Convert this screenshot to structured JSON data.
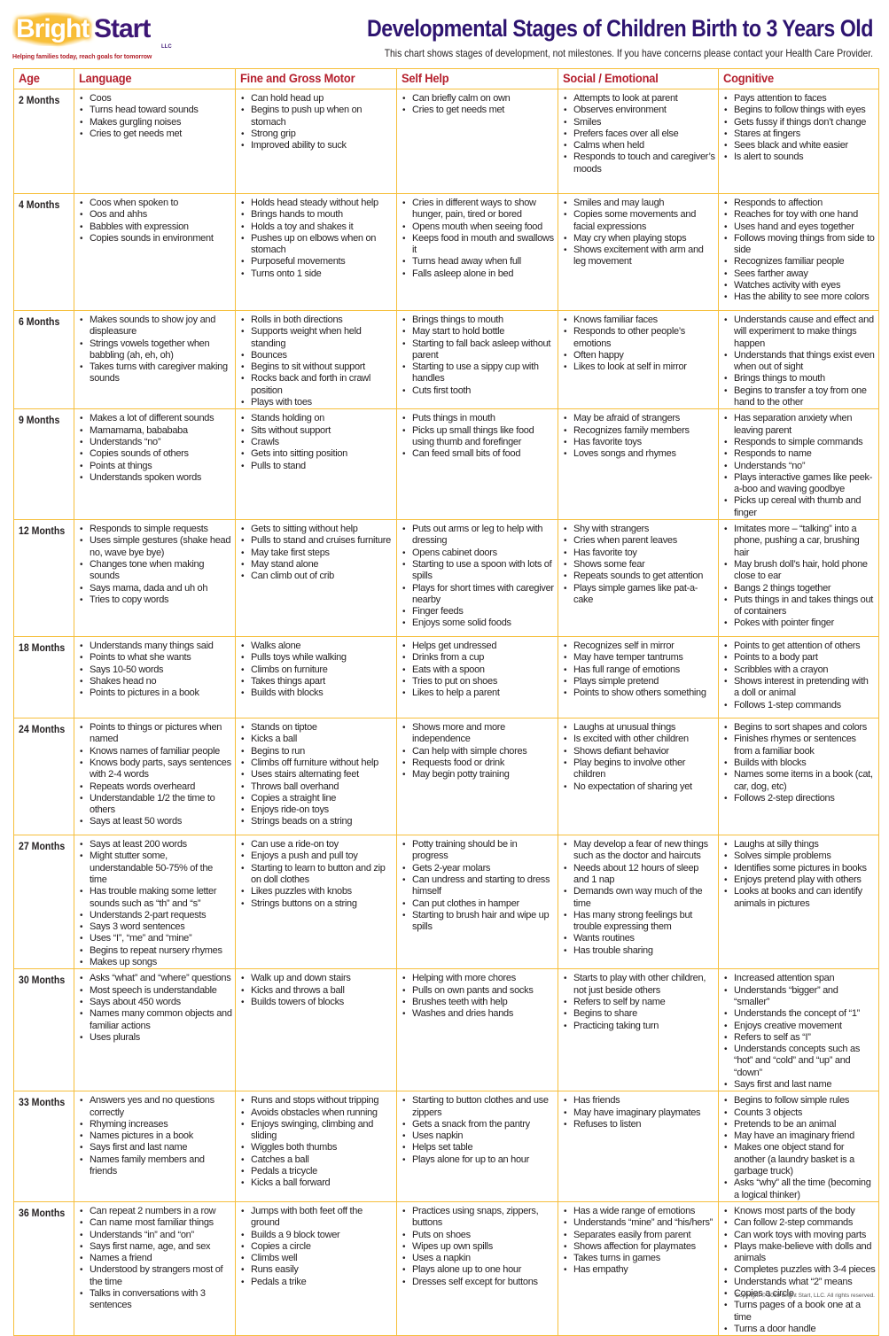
{
  "logo": {
    "bright": "Bright",
    "start": "Start",
    "llc": "LLC",
    "tagline": "Helping families today, reach goals for tomorrow",
    "colors": {
      "bright_glow": "#f8c03f",
      "start": "#3d1675",
      "tagline": "#b2202a"
    }
  },
  "header": {
    "title": "Developmental Stages of Children Birth to 3 Years Old",
    "subtitle": "This chart shows stages of development, not milestones. If you have concerns please contact your Health Care Provider."
  },
  "colors": {
    "title": "#2e1470",
    "column_header": "#b5202e",
    "grid": "#f6bf3c",
    "text": "#231f20"
  },
  "columns": [
    "Age",
    "Language",
    "Fine and Gross Motor",
    "Self Help",
    "Social / Emotional",
    "Cognitive"
  ],
  "rows": [
    {
      "age": "2 Months",
      "language": [
        "Coos",
        "Turns head toward sounds",
        "Makes gurgling noises",
        "Cries to get needs met"
      ],
      "motor": [
        "Can hold head up",
        "Begins to push up when on stomach",
        "Strong grip",
        "Improved ability to suck"
      ],
      "self_help": [
        "Can briefly calm on own",
        "Cries to get needs met"
      ],
      "social": [
        "Attempts to look at parent",
        "Observes environment",
        "Smiles",
        "Prefers faces over all else",
        "Calms when held",
        "Responds to touch and caregiver’s moods"
      ],
      "cognitive": [
        "Pays attention to faces",
        "Begins to follow things with eyes",
        "Gets fussy if things don’t change",
        "Stares at fingers",
        "Sees black and white easier",
        "Is alert to sounds"
      ]
    },
    {
      "age": "4 Months",
      "language": [
        "Coos when spoken to",
        "Oos and ahhs",
        "Babbles with expression",
        "Copies sounds in environment"
      ],
      "motor": [
        "Holds head steady without help",
        "Brings hands to mouth",
        "Holds a toy and shakes it",
        "Pushes up on elbows when on stomach",
        "Purposeful movements",
        "Turns onto 1 side"
      ],
      "self_help": [
        "Cries in different ways to show hunger, pain, tired or bored",
        "Opens mouth when seeing food",
        "Keeps food in mouth and swallows it",
        "Turns head away when full",
        "Falls asleep alone in bed"
      ],
      "social": [
        "Smiles and may laugh",
        "Copies some movements and facial expressions",
        "May cry when playing stops",
        "Shows excitement with arm and leg movement"
      ],
      "cognitive": [
        "Responds to affection",
        "Reaches for toy with one hand",
        "Uses hand and eyes together",
        "Follows moving things from side to side",
        "Recognizes familiar people",
        "Sees farther away",
        "Watches activity with eyes",
        "Has the ability to see more colors"
      ]
    },
    {
      "age": "6 Months",
      "language": [
        "Makes sounds to show joy and displeasure",
        "Strings vowels together when babbling (ah, eh, oh)",
        "Takes turns with caregiver making sounds"
      ],
      "motor": [
        "Rolls in both directions",
        "Supports weight when held standing",
        "Bounces",
        "Begins to sit without support",
        "Rocks back and forth in crawl position",
        "Plays with toes"
      ],
      "self_help": [
        "Brings things to mouth",
        "May start to hold bottle",
        "Starting to fall back asleep without parent",
        "Starting to use a sippy cup with handles",
        "Cuts first tooth"
      ],
      "social": [
        "Knows familiar faces",
        "Responds to other people’s emotions",
        "Often happy",
        "Likes to look at self in mirror"
      ],
      "cognitive": [
        "Understands cause and effect and will experiment to make things happen",
        "Understands that things exist even when out of sight",
        "Brings things to mouth",
        "Begins to transfer a toy from one hand to the other"
      ]
    },
    {
      "age": "9 Months",
      "language": [
        "Makes a lot of different sounds",
        "Mamamama, babababa",
        "Understands “no”",
        "Copies sounds of others",
        "Points at things",
        "Understands spoken words"
      ],
      "motor": [
        "Stands holding on",
        "Sits without support",
        "Crawls",
        "Gets into sitting position",
        "Pulls to stand"
      ],
      "self_help": [
        "Puts things in mouth",
        "Picks up small things like food using thumb and forefinger",
        "Can feed small bits of food"
      ],
      "social": [
        "May be afraid of strangers",
        "Recognizes family members",
        "Has favorite toys",
        "Loves songs and rhymes"
      ],
      "cognitive": [
        "Has separation anxiety when leaving parent",
        "Responds to simple commands",
        "Responds to name",
        "Understands “no”",
        "Plays interactive games like peek-a-boo and waving goodbye",
        "Picks up cereal with thumb and finger"
      ]
    },
    {
      "age": "12 Months",
      "language": [
        "Responds to simple requests",
        "Uses simple gestures (shake head no, wave bye bye)",
        "Changes tone when making sounds",
        "Says mama, dada and uh oh",
        "Tries to copy words"
      ],
      "motor": [
        "Gets to sitting without help",
        "Pulls to stand and cruises furniture",
        "May take first steps",
        "May stand alone",
        "Can climb out of crib"
      ],
      "self_help": [
        "Puts out arms or leg to help with dressing",
        "Opens cabinet doors",
        "Starting to use a spoon with lots of spills",
        "Plays for short times with caregiver nearby",
        "Finger feeds",
        "Enjoys some solid foods"
      ],
      "social": [
        "Shy with strangers",
        "Cries when parent leaves",
        "Has favorite toy",
        "Shows some fear",
        "Repeats sounds to get attention",
        "Plays simple games like pat-a-cake"
      ],
      "cognitive": [
        "Imitates more – “talking” into a phone, pushing a car, brushing hair",
        "May brush doll’s hair, hold phone close to ear",
        "Bangs 2 things together",
        "Puts things in and takes things out of containers",
        "Pokes with pointer finger"
      ]
    },
    {
      "age": "18 Months",
      "language": [
        "Understands many things said",
        "Points to what she wants",
        "Says 10-50 words",
        "Shakes head no",
        "Points to pictures in a book"
      ],
      "motor": [
        "Walks alone",
        "Pulls toys while walking",
        "Climbs on furniture",
        "Takes things apart",
        "Builds with blocks"
      ],
      "self_help": [
        "Helps get undressed",
        "Drinks from a cup",
        "Eats with a spoon",
        "Tries to put on shoes",
        "Likes to help a parent"
      ],
      "social": [
        "Recognizes self in mirror",
        "May have temper tantrums",
        "Has full range of emotions",
        "Plays simple pretend",
        "Points to show others something"
      ],
      "cognitive": [
        "Points to get attention of others",
        "Points to a body part",
        "Scribbles with a crayon",
        "Shows interest in pretending with a doll or animal",
        "Follows 1-step commands"
      ]
    },
    {
      "age": "24 Months",
      "language": [
        "Points to things or pictures when named",
        "Knows names of familiar people",
        "Knows body parts, says sentences with 2-4 words",
        "Repeats words overheard",
        "Understandable 1/2 the time to others",
        "Says at least 50 words"
      ],
      "motor": [
        "Stands on tiptoe",
        "Kicks a ball",
        "Begins to run",
        "Climbs off furniture without help",
        "Uses stairs alternating feet",
        "Throws ball overhand",
        "Copies a straight line",
        "Enjoys ride-on toys",
        "Strings beads on a string"
      ],
      "self_help": [
        "Shows more and more independence",
        "Can help with simple chores",
        "Requests food or drink",
        "May begin potty training"
      ],
      "social": [
        "Laughs at unusual things",
        "Is excited with other children",
        "Shows defiant behavior",
        "Play begins to involve other children",
        "No expectation of sharing yet"
      ],
      "cognitive": [
        "Begins to sort shapes and colors",
        "Finishes rhymes or sentences from a familiar book",
        "Builds with blocks",
        "Names some items in a book (cat, car, dog, etc)",
        "Follows 2-step directions"
      ]
    },
    {
      "age": "27 Months",
      "language": [
        "Says at least 200 words",
        "Might stutter some, understandable 50-75% of the time",
        "Has trouble making some letter sounds such as “th” and “s”",
        "Understands 2-part requests",
        "Says 3 word sentences",
        "Uses “I”, “me” and “mine”",
        "Begins to repeat nursery rhymes",
        "Makes up songs"
      ],
      "motor": [
        "Can use a ride-on toy",
        "Enjoys a push and pull toy",
        "Starting to learn to button and zip on doll clothes",
        "Likes puzzles with knobs",
        "Strings buttons on a string"
      ],
      "self_help": [
        "Potty training should be in progress",
        "Gets 2-year molars",
        "Can undress and starting to dress himself",
        "Can put clothes in hamper",
        "Starting to brush hair and wipe up spills"
      ],
      "social": [
        "May develop a fear of new things such as the doctor and haircuts",
        "Needs about 12 hours of sleep and 1 nap",
        "Demands own way much of the time",
        "Has many strong feelings but trouble expressing them",
        "Wants routines",
        "Has trouble sharing"
      ],
      "cognitive": [
        "Laughs at silly things",
        "Solves simple problems",
        "Identifies some pictures in books",
        "Enjoys pretend play with others",
        "Looks at books and can identify animals in pictures"
      ]
    },
    {
      "age": "30 Months",
      "language": [
        "Asks “what” and “where” questions",
        "Most speech is understandable",
        "Says about 450 words",
        "Names many common objects and familiar actions",
        "Uses plurals"
      ],
      "motor": [
        "Walk up and down stairs",
        "Kicks and throws a ball",
        "Builds towers of blocks"
      ],
      "self_help": [
        "Helping with more chores",
        "Pulls on own pants and socks",
        "Brushes teeth with help",
        "Washes and dries hands"
      ],
      "social": [
        "Starts to play with other children, not just beside others",
        "Refers to self by name",
        "Begins to share",
        "Practicing taking turn"
      ],
      "cognitive": [
        "Increased attention span",
        "Understands “bigger” and “smaller”",
        "Understands the concept of “1”",
        "Enjoys creative movement",
        "Refers to self as “I”",
        "Understands concepts such as “hot” and “cold” and “up” and “down”",
        "Says first and last name"
      ]
    },
    {
      "age": "33 Months",
      "language": [
        "Answers yes and no questions correctly",
        "Rhyming increases",
        "Names pictures in a book",
        "Says first and last name",
        "Names family members and friends"
      ],
      "motor": [
        "Runs and stops without tripping",
        "Avoids obstacles when running",
        "Enjoys swinging, climbing and sliding",
        "Wiggles both thumbs",
        "Catches a ball",
        "Pedals a tricycle",
        "Kicks a ball forward"
      ],
      "self_help": [
        "Starting to button clothes and use zippers",
        "Gets a snack from the pantry",
        "Uses napkin",
        "Helps set table",
        "Plays alone for up to an hour"
      ],
      "social": [
        "Has friends",
        "May have imaginary playmates",
        "Refuses to listen"
      ],
      "cognitive": [
        "Begins to follow simple rules",
        "Counts 3 objects",
        "Pretends to be an animal",
        "May have an imaginary friend",
        "Makes one object stand for another (a laundry basket is a garbage truck)",
        "Asks “why” all the time (becoming a logical thinker)"
      ]
    },
    {
      "age": "36 Months",
      "language": [
        "Can repeat 2 numbers in a row",
        "Can name most familiar things",
        "Understands “in” and “on”",
        "Says first name, age, and sex",
        "Names a friend",
        "Understood by strangers most of the time",
        "Talks in conversations with 3 sentences"
      ],
      "motor": [
        "Jumps with both feet off the ground",
        "Builds a 9 block tower",
        "Copies a circle",
        "Climbs well",
        "Runs easily",
        "Pedals a trike"
      ],
      "self_help": [
        "Practices using snaps, zippers, buttons",
        "Puts on shoes",
        "Wipes up own spills",
        "Uses a napkin",
        "Plays alone up to one hour",
        "Dresses self except for buttons"
      ],
      "social": [
        "Has a wide range of emotions",
        "Understands “mine” and “his/hers”",
        "Separates easily from parent",
        "Shows affection for playmates",
        "Takes turns in games",
        "Has empathy"
      ],
      "cognitive": [
        "Knows most parts of the body",
        "Can follow 2-step commands",
        "Can work toys with moving parts",
        "Plays make-believe with dolls and animals",
        "Completes puzzles with 3-4 pieces",
        "Understands what “2” means",
        "Copies a circle",
        "Turns pages of a book one at a time",
        "Turns a door handle"
      ]
    }
  ],
  "footer": {
    "copyright": "Copyright © 2019 Bright Start, LLC. All rights reserved."
  }
}
